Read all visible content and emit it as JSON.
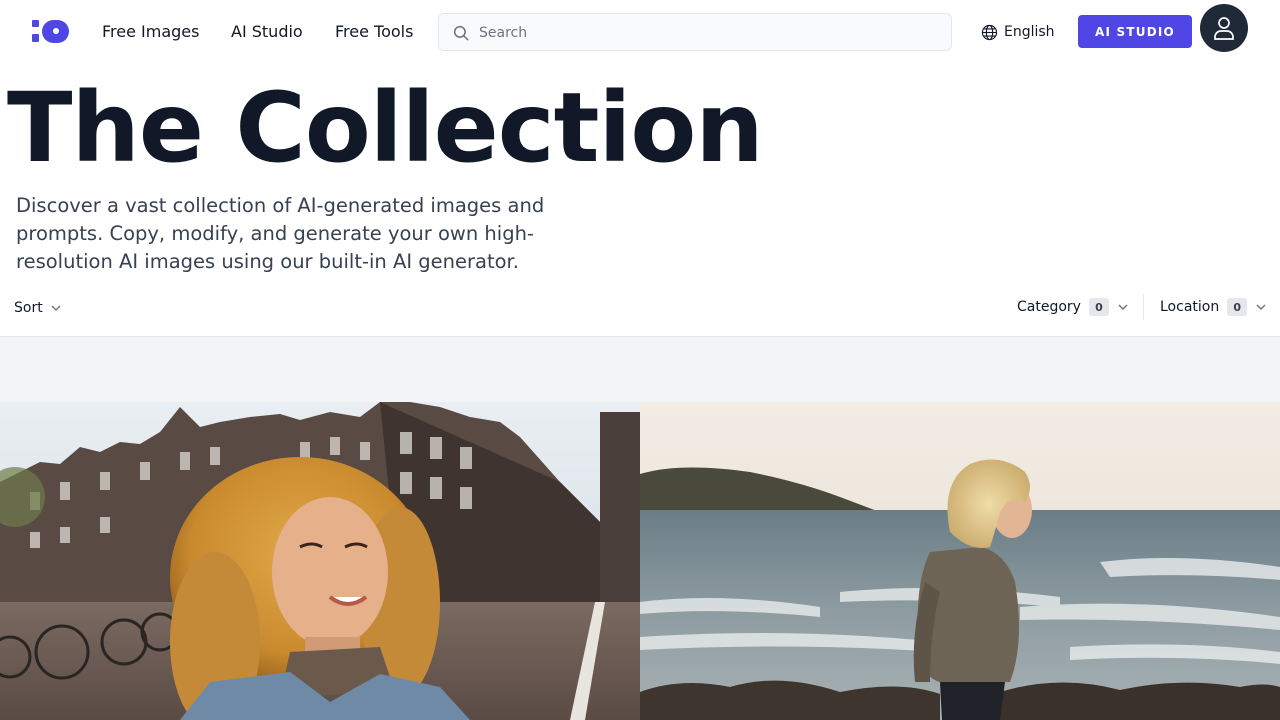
{
  "header": {
    "nav": [
      "Free Images",
      "AI Studio",
      "Free Tools"
    ],
    "search_placeholder": "Search",
    "language": "English",
    "ai_studio_button": "AI STUDIO",
    "brand_color": "#4f46e5"
  },
  "hero": {
    "title": "The Collection",
    "description": "Discover a vast collection of AI-generated images and prompts. Copy, modify, and generate your own high-resolution AI images using our built-in AI generator."
  },
  "filters": {
    "sort_label": "Sort",
    "category_label": "Category",
    "category_count": "0",
    "location_label": "Location",
    "location_count": "0"
  },
  "gallery": {
    "images": [
      {
        "subject": "Curly-haired woman smiling on an Amsterdam canal street"
      },
      {
        "subject": "Blonde child in a knitted sweater by the sea at sunset"
      }
    ]
  },
  "icons": [
    "logo-icon",
    "search-icon",
    "globe-icon",
    "user-icon",
    "chevron-down-icon"
  ]
}
